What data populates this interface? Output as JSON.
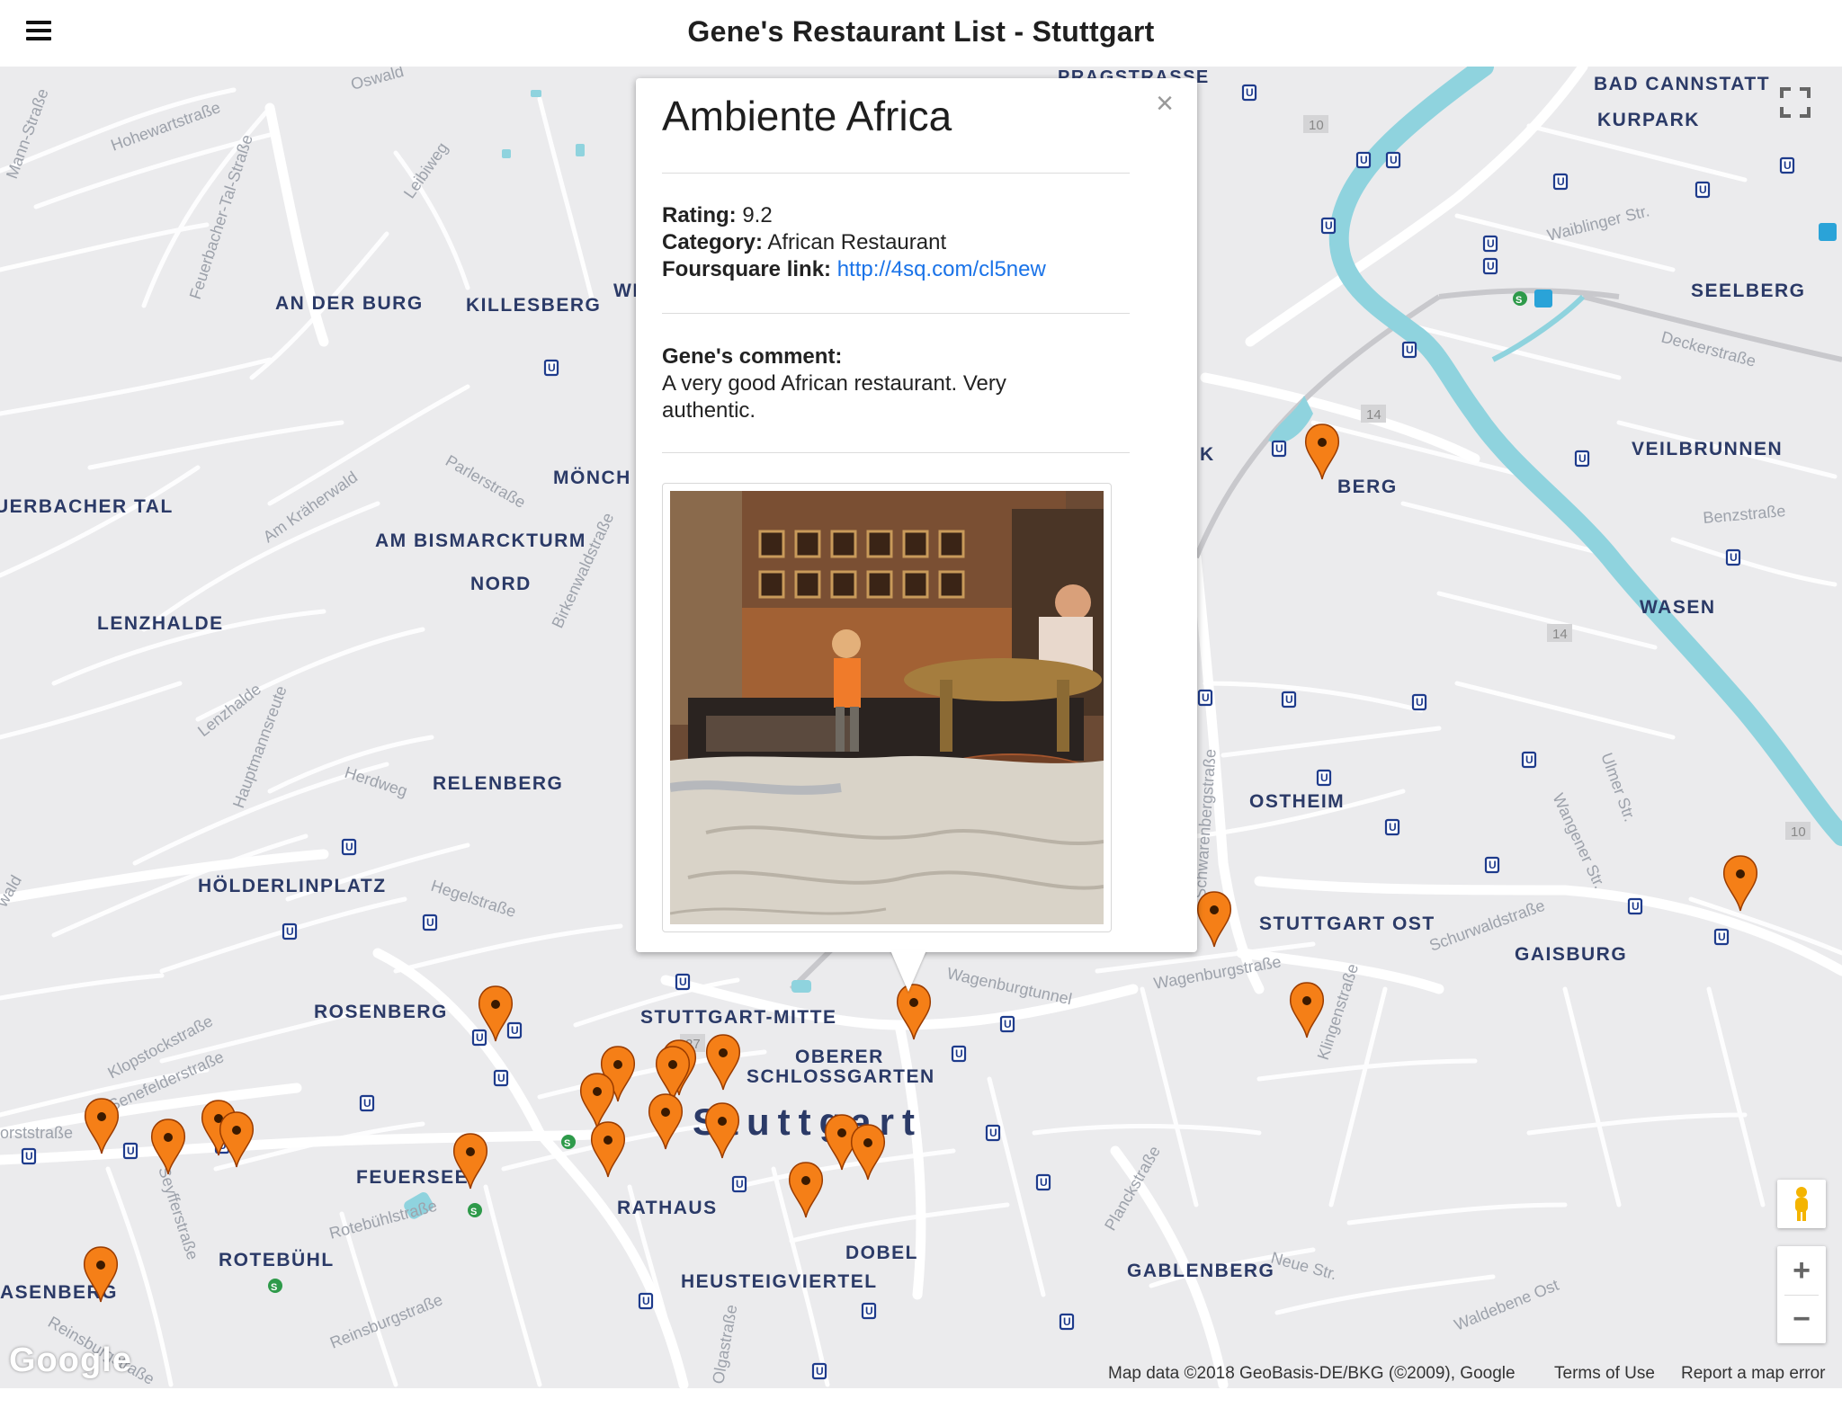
{
  "header": {
    "title": "Gene's Restaurant List - Stuttgart",
    "menu_icon": "hamburger-icon"
  },
  "map": {
    "city_label": "Stuttgart",
    "districts": [
      "BAD CANNSTATT",
      "KURPARK",
      "PRAGSTRASSE",
      "AN DER BURG",
      "KILLESBERG",
      "WI",
      "SEELBERG",
      "MÖNCH",
      "BERG",
      "VEILBRUNNEN",
      "UERBACHER TAL",
      "AM BISMARCKTURM",
      "NORD",
      "LENZHALDE",
      "WASEN",
      "RELENBERG",
      "OSTHEIM",
      "HÖLDERLINPLATZ",
      "STUTTGART OST",
      "GAISBURG",
      "ROSENBERG",
      "STUTTGART-MITTE",
      "OBERER",
      "SCHLOSSGARTEN",
      "FEUERSEE",
      "RATHAUS",
      "ROTEBÜHL",
      "DOBEL",
      "HEUSTEIGVIERTEL",
      "GABLENBERG",
      "ASENBERG",
      "K"
    ],
    "streets": [
      "Hohewartstraße",
      "Feuerbacher-Tal-Straße",
      "Leibiweg",
      "Oswald",
      "Waiblinger Str.",
      "Deckerstraße",
      "Parlerstraße",
      "Am Kräherwald",
      "Benzstraße",
      "Birkenwaldstraße",
      "Lenzhalde",
      "Hauptmannsreute",
      "Herdweg",
      "Hegelstraße",
      "Ulmer Str.",
      "Wangener Str.",
      "Schurwaldstraße",
      "Wagenburgstraße",
      "Wagenburgtunnel",
      "Klopstockstraße",
      "Senefelderstraße",
      "Rotebühlstraße",
      "Seyfferstraße",
      "Klingenstraße",
      "Planckstraße",
      "Neue Str.",
      "Waldebene Ost",
      "Reinsburgstraße",
      "Mann-Straße",
      "wald",
      "orststraße",
      "Schwarenbergstraße",
      "Olgastraße"
    ],
    "route_numbers": [
      "10",
      "14",
      "14",
      "10",
      "27",
      "27"
    ],
    "controls": {
      "fullscreen_icon": "fullscreen-icon",
      "pegman_icon": "pegman-icon",
      "zoom_in": "+",
      "zoom_out": "−"
    },
    "logo": "Google",
    "attribution": "Map data ©2018 GeoBasis-DE/BKG (©2009), Google",
    "terms": "Terms of Use",
    "report": "Report a map error",
    "marker_color": "#f57f17"
  },
  "infowindow": {
    "title": "Ambiente Africa",
    "rating_label": "Rating:",
    "rating": "9.2",
    "category_label": "Category:",
    "category": "African Restaurant",
    "link_label": "Foursquare link:",
    "link": "http://4sq.com/cl5new",
    "comment_label": "Gene's comment:",
    "comment_line1": "A very good African restaurant. Very",
    "comment_line2": "authentic.",
    "close_icon": "×"
  }
}
